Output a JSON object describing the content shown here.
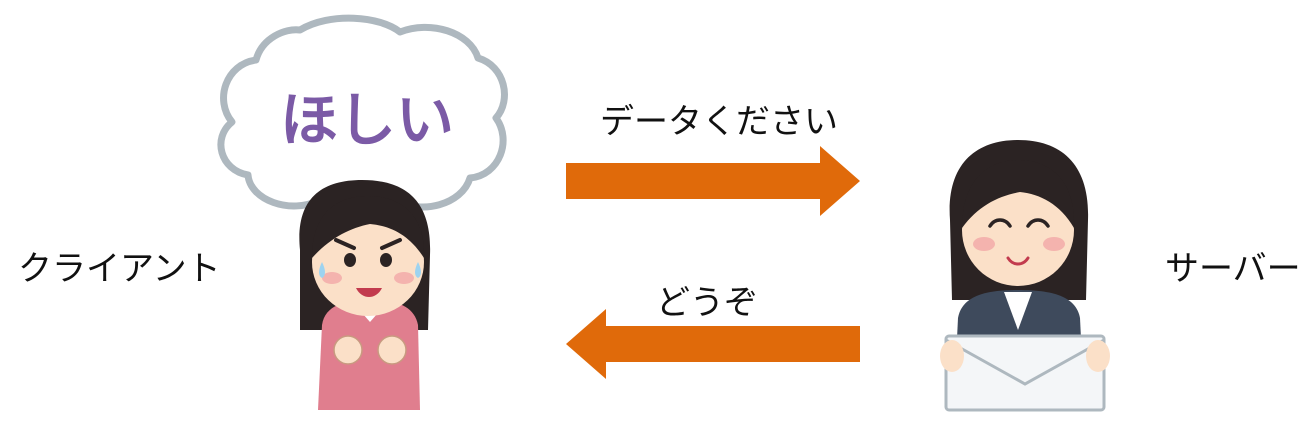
{
  "client": {
    "label": "クライアント",
    "thought": "ほしい"
  },
  "server": {
    "label": "サーバー"
  },
  "request": {
    "label": "データください",
    "direction": "client-to-server"
  },
  "response": {
    "label": "どうぞ",
    "direction": "server-to-client"
  },
  "colors": {
    "arrow": "#E06A0A",
    "thought_text": "#7B5AA6",
    "thought_outline": "#AEB8BF",
    "hair": "#2B2323",
    "skin": "#FBE0C8",
    "client_outfit": "#E07E8E",
    "server_outfit": "#3E4A5C",
    "envelope": "#F4F6F8"
  }
}
